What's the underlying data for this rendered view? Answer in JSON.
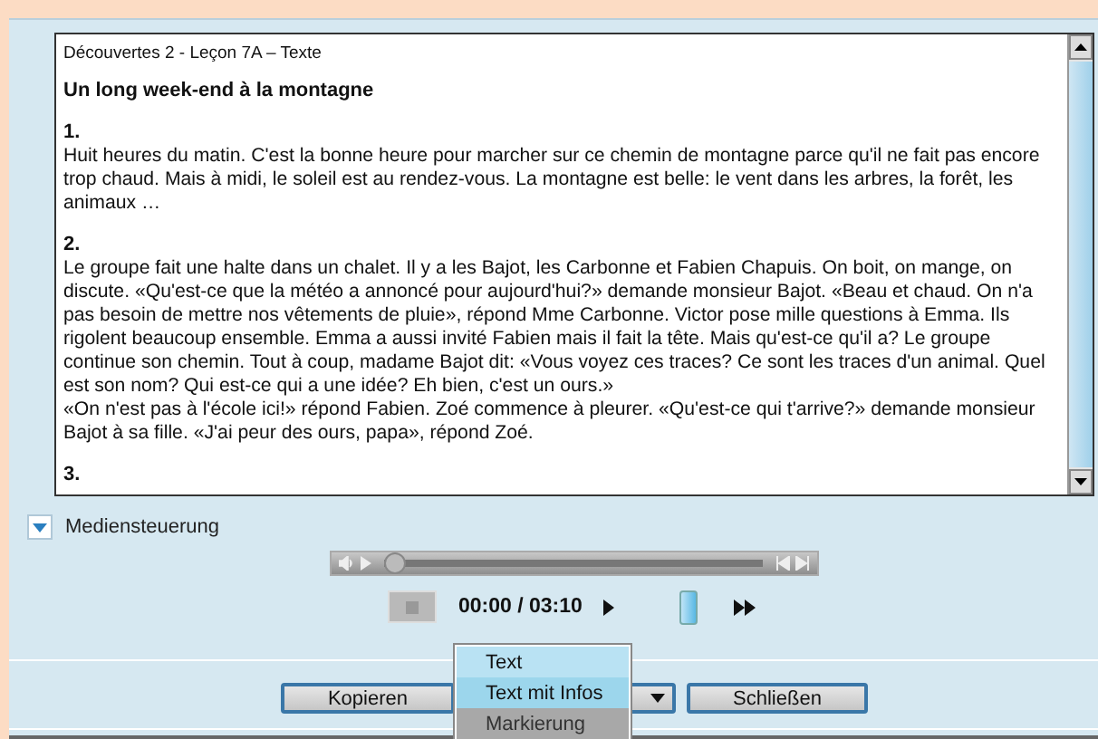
{
  "document": {
    "header": "Découvertes 2 - Leçon 7A – Texte",
    "title": "Un long week-end à la montagne",
    "sections": [
      {
        "number": "1.",
        "paragraphs": [
          "Huit heures du matin. C'est la bonne heure pour marcher sur ce chemin de montagne parce qu'il ne fait pas encore trop chaud. Mais à midi, le soleil est au rendez-vous. La montagne est belle: le vent dans les arbres, la forêt, les animaux …"
        ]
      },
      {
        "number": "2.",
        "paragraphs": [
          "Le groupe fait une halte dans un chalet. Il y a les Bajot, les Carbonne et Fabien Chapuis. On boit, on mange, on discute. «Qu'est-ce que la météo a annoncé pour aujourd'hui?» demande monsieur Bajot. «Beau et chaud. On n'a pas besoin de mettre nos vêtements de pluie», répond Mme Carbonne. Victor pose mille questions à Emma. Ils rigolent beaucoup ensemble. Emma a aussi invité Fabien mais il fait la tête. Mais qu'est-ce qu'il a? Le groupe continue son chemin. Tout à coup, madame Bajot dit: «Vous voyez ces traces? Ce sont les traces d'un animal. Quel est son nom? Qui est-ce qui a une idée? Eh bien, c'est un ours.»",
          "«On n'est pas à l'école ici!» répond Fabien. Zoé commence à pleurer. «Qu'est-ce qui t'arrive?» demande monsieur Bajot à sa fille. «J'ai peur des ours, papa», répond Zoé."
        ]
      },
      {
        "number": "3."
      }
    ]
  },
  "media": {
    "label": "Mediensteuerung",
    "expanded": true,
    "progress": {
      "level": 0
    },
    "time": "00:00 / 03:10",
    "speed": {
      "level": 0.6
    }
  },
  "buttons": [
    {
      "label": "Kopieren",
      "kind": "button"
    },
    {
      "kind": "dropdown"
    },
    {
      "label": "Schließen",
      "kind": "button"
    }
  ],
  "menu": [
    {
      "label": "Text",
      "selected": false,
      "disabled": false
    },
    {
      "label": "Text mit Infos",
      "selected": true,
      "disabled": false
    },
    {
      "label": "Markierung",
      "selected": false,
      "disabled": true
    }
  ]
}
